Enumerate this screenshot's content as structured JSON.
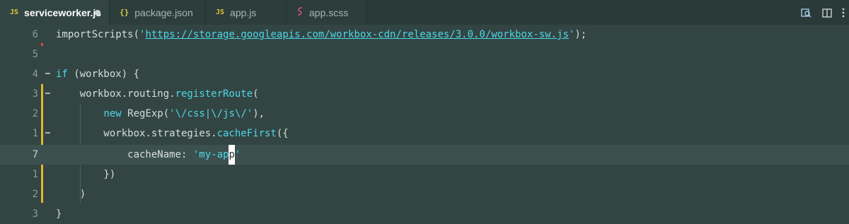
{
  "tabs": [
    {
      "label": "serviceworker.js",
      "icon": "JS",
      "active": true,
      "modified": true
    },
    {
      "label": "package.json",
      "icon": "{}",
      "active": false
    },
    {
      "label": "app.js",
      "icon": "JS",
      "active": false
    },
    {
      "label": "app.scss",
      "icon": "scss-icon",
      "active": false
    }
  ],
  "toolbar": {
    "icons": [
      "open-changes-icon",
      "split-editor-icon",
      "more-actions-icon"
    ]
  },
  "colors": {
    "background": "#324543",
    "accent": "#4fd6e6",
    "modified_gutter": "#e3b52b"
  },
  "lines": [
    {
      "num": "6",
      "tokens": [
        [
          "plain",
          "importScripts("
        ],
        [
          "str",
          "'"
        ],
        [
          "url",
          "https://storage.googleapis.com/workbox-cdn/releases/3.0.0/workbox-sw.js"
        ],
        [
          "str",
          "'"
        ],
        [
          "plain",
          ");"
        ]
      ]
    },
    {
      "num": "5",
      "tokens": []
    },
    {
      "num": "4",
      "tokens": [
        [
          "kw",
          "if"
        ],
        [
          "plain",
          " (workbox) {"
        ]
      ]
    },
    {
      "num": "3",
      "tokens": [
        [
          "plain",
          "    workbox.routing."
        ],
        [
          "fn",
          "registerRoute"
        ],
        [
          "plain",
          "("
        ]
      ]
    },
    {
      "num": "2",
      "tokens": [
        [
          "plain",
          "        "
        ],
        [
          "kw",
          "new"
        ],
        [
          "plain",
          " RegExp("
        ],
        [
          "str",
          "'\\/css|\\/js\\/'"
        ],
        [
          "plain",
          "),"
        ]
      ]
    },
    {
      "num": "1",
      "tokens": [
        [
          "plain",
          "        workbox.strategies."
        ],
        [
          "fn",
          "cacheFirst"
        ],
        [
          "plain",
          "({"
        ]
      ]
    },
    {
      "num": "7",
      "tokens": [
        [
          "plain",
          "            cacheName: "
        ],
        [
          "str",
          "'my-ap"
        ],
        [
          "cursor",
          "p"
        ],
        [
          "str",
          "'"
        ]
      ]
    },
    {
      "num": "1",
      "tokens": [
        [
          "plain",
          "        })"
        ]
      ]
    },
    {
      "num": "2",
      "tokens": [
        [
          "plain",
          "    )"
        ]
      ]
    },
    {
      "num": "3",
      "tokens": [
        [
          "plain",
          "}"
        ]
      ]
    }
  ]
}
